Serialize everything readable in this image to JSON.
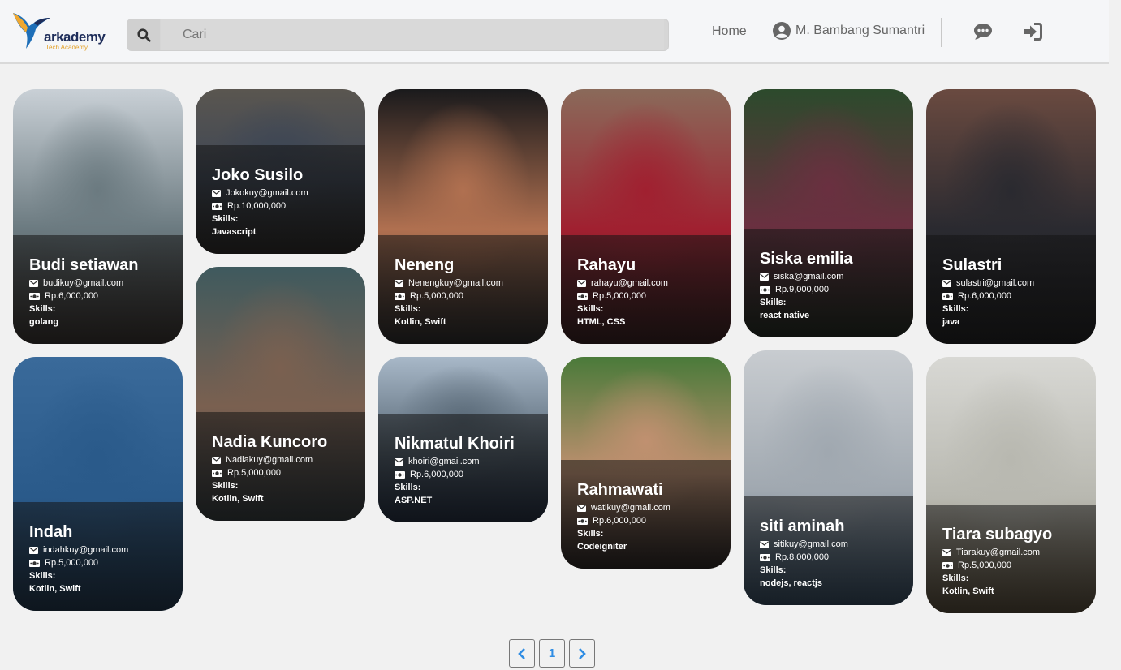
{
  "header": {
    "logo_text": "arkademy",
    "logo_sub": "Tech Academy",
    "search_placeholder": "Cari",
    "nav_home": "Home",
    "nav_user": "M. Bambang Sumantri"
  },
  "skills_label": "Skills:",
  "cards": [
    {
      "name": "Budi setiawan",
      "email": "budikuy@gmail.com",
      "salary": "Rp.6,000,000",
      "skills": "golang",
      "photo": [
        "#c9d0d6",
        "#6b7a80",
        "#3d3530"
      ]
    },
    {
      "name": "Joko Susilo",
      "email": "Jokokuy@gmail.com",
      "salary": "Rp.10,000,000",
      "skills": "Javascript",
      "photo": [
        "#5a5650",
        "#3d4655",
        "#2d2a26"
      ]
    },
    {
      "name": "Neneng",
      "email": "Nenengkuy@gmail.com",
      "salary": "Rp.5,000,000",
      "skills": "Kotlin, Swift",
      "photo": [
        "#1a1a1c",
        "#b07050",
        "#2a2a2a"
      ]
    },
    {
      "name": "Rahayu",
      "email": "rahayu@gmail.com",
      "salary": "Rp.5,000,000",
      "skills": "HTML, CSS",
      "photo": [
        "#8a6a5a",
        "#a02030",
        "#3a1a1a"
      ]
    },
    {
      "name": "Siska emilia",
      "email": "siska@gmail.com",
      "salary": "Rp.9,000,000",
      "skills": "react native",
      "photo": [
        "#2c4a2c",
        "#6a3040",
        "#1e2a1e"
      ]
    },
    {
      "name": "Sulastri",
      "email": "sulastri@gmail.com",
      "salary": "Rp.6,000,000",
      "skills": "java",
      "photo": [
        "#6a4a40",
        "#2a2a30",
        "#1a1a1c"
      ]
    },
    {
      "name": "Indah",
      "email": "indahkuy@gmail.com",
      "salary": "Rp.5,000,000",
      "skills": "Kotlin, Swift",
      "photo": [
        "#3a6a9a",
        "#2a5a8a",
        "#1a3a5a"
      ]
    },
    {
      "name": "Nadia Kuncoro",
      "email": "Nadiakuy@gmail.com",
      "salary": "Rp.5,000,000",
      "skills": "Kotlin, Swift",
      "photo": [
        "#3f5a5e",
        "#7a6050",
        "#3a4448"
      ]
    },
    {
      "name": "Nikmatul Khoiri",
      "email": "khoiri@gmail.com",
      "salary": "Rp.6,000,000",
      "skills": "ASP.NET",
      "photo": [
        "#a8b8c8",
        "#5a6a78",
        "#1f2f4a"
      ]
    },
    {
      "name": "Rahmawati",
      "email": "watikuy@gmail.com",
      "salary": "Rp.6,000,000",
      "skills": "Codeigniter",
      "photo": [
        "#4a7a3a",
        "#c09070",
        "#2a2220"
      ]
    },
    {
      "name": "siti aminah",
      "email": "sitikuy@gmail.com",
      "salary": "Rp.8,000,000",
      "skills": "nodejs, reactjs",
      "photo": [
        "#c8ccd0",
        "#a0a8b0",
        "#3a5a78"
      ]
    },
    {
      "name": "Tiara subagyo",
      "email": "Tiarakuy@gmail.com",
      "salary": "Rp.5,000,000",
      "skills": "Kotlin, Swift",
      "photo": [
        "#d8d8d4",
        "#b8b8b0",
        "#6a5a40"
      ]
    }
  ],
  "pagination": {
    "prev": "‹",
    "current": "1",
    "next": "›"
  },
  "colors": {
    "accent": "#2f8de4",
    "header_bg": "#f5f6f8",
    "page_bg": "#f1f1f1"
  }
}
